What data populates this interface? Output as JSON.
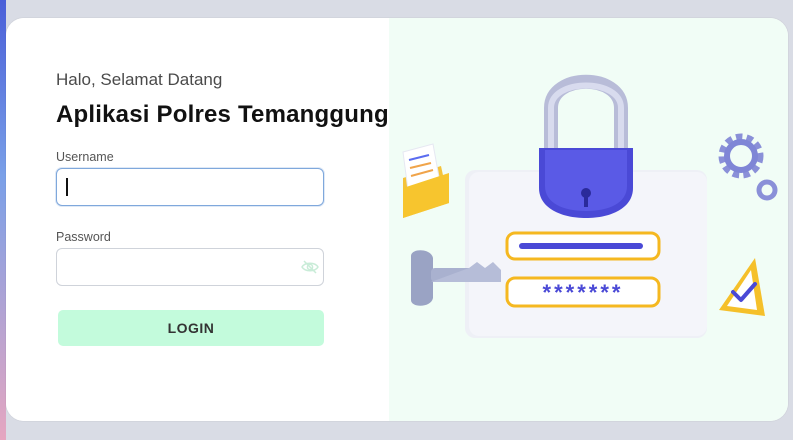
{
  "login": {
    "greeting": "Halo, Selamat Datang",
    "app_title": "Aplikasi Polres Temanggung",
    "username_label": "Username",
    "username_value": "",
    "password_label": "Password",
    "password_value": "",
    "login_button": "LOGIN"
  },
  "illustration": {
    "password_mask": "*******"
  },
  "colors": {
    "accent_button": "#c3fbdc",
    "art_background": "#f1fdf6",
    "lock_body": "#4a49d6",
    "frame_yellow": "#f5b820"
  },
  "icons": [
    "eye-slash-icon",
    "padlock-icon",
    "key-icon",
    "gear-icon",
    "envelope-icon",
    "warning-check-icon"
  ]
}
